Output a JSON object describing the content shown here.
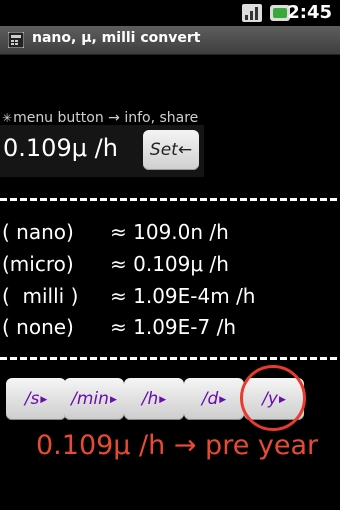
{
  "status_bar": {
    "time": "2:45",
    "icons": [
      "signal-icon",
      "battery-icon"
    ]
  },
  "title_bar": {
    "title": "nano, μ, milli convert",
    "icon": "app-icon"
  },
  "hint": {
    "text": "menu button → info, share"
  },
  "display": {
    "value": "0.109μ /h",
    "set_label": "Set←"
  },
  "results": [
    {
      "unit": "( nano)",
      "value": "≈ 109.0n /h"
    },
    {
      "unit": "(micro)",
      "value": "≈ 0.109μ /h"
    },
    {
      "unit": "(  milli )",
      "value": "≈ 1.09E-4m /h"
    },
    {
      "unit": "( none)",
      "value": "≈ 1.09E-7 /h"
    }
  ],
  "time_buttons": [
    {
      "label": "/s"
    },
    {
      "label": "/min"
    },
    {
      "label": "/h"
    },
    {
      "label": "/d"
    },
    {
      "label": "/y"
    }
  ],
  "annotation": {
    "text": "0.109μ /h → pre year",
    "color": "#e84a35"
  },
  "colors": {
    "button_text": "#6a0fa8",
    "highlight": "#e83b2b"
  }
}
